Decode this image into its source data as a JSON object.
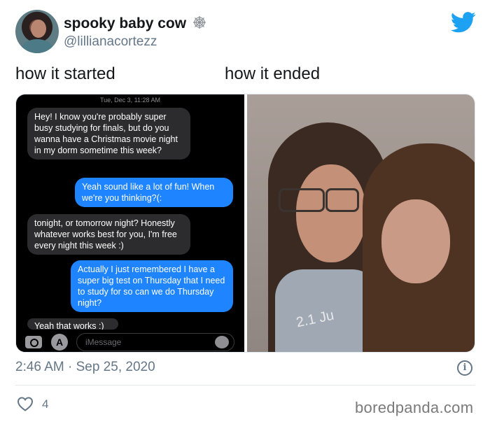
{
  "author": {
    "display_name": "spooky baby cow",
    "handle": "@lillianacortezz"
  },
  "captions": {
    "left": "how it started",
    "right": "how it ended"
  },
  "screenshot": {
    "timestamp": "Tue, Dec 3, 11:28 AM",
    "messages": [
      {
        "from": "them",
        "text": "Hey! I know you're probably super busy studying for finals, but do you wanna have a Christmas movie night in my dorm sometime this week?"
      },
      {
        "from": "me",
        "text": "Yeah sound like a lot of fun! When we're you thinking?(:"
      },
      {
        "from": "them",
        "text": "tonight, or tomorrow night? Honestly whatever works best for you, I'm free every night this week :)"
      },
      {
        "from": "me",
        "text": "Actually I just remembered I have a super big test on Thursday that I need to study for so can we do Thursday night?"
      },
      {
        "from": "them",
        "text": "Yeah that works :)"
      }
    ],
    "input_placeholder": "iMessage",
    "icons": [
      "camera-icon",
      "app-store-icon",
      "audio-icon"
    ]
  },
  "photo": {
    "shirt_text": "2.1 Ju"
  },
  "tweet": {
    "time": "2:46 AM · Sep 25, 2020",
    "likes": "4"
  },
  "watermark": "boredpanda.com",
  "colors": {
    "twitter_blue": "#1da1f2",
    "imessage_blue": "#1f84ff",
    "muted": "#657786"
  }
}
